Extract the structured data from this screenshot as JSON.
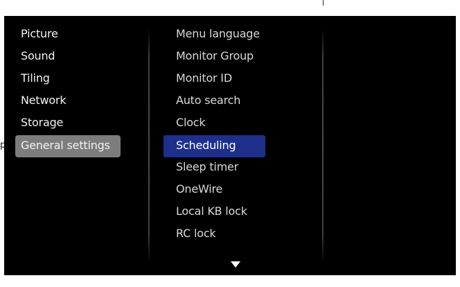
{
  "left_menu": {
    "items": [
      {
        "label": "Picture"
      },
      {
        "label": "Sound"
      },
      {
        "label": "Tiling"
      },
      {
        "label": "Network"
      },
      {
        "label": "Storage"
      },
      {
        "label": "General settings"
      }
    ],
    "selected_label": "General settings"
  },
  "sub_menu": {
    "items": [
      {
        "label": "Menu language"
      },
      {
        "label": "Monitor Group"
      },
      {
        "label": "Monitor ID"
      },
      {
        "label": "Auto search"
      },
      {
        "label": "Clock"
      },
      {
        "label": "Scheduling"
      },
      {
        "label": "Sleep timer"
      },
      {
        "label": "OneWire"
      },
      {
        "label": "Local KB lock"
      },
      {
        "label": "RC lock"
      }
    ],
    "selected_label": "Scheduling",
    "more_indicator": "down-triangle-icon"
  },
  "colors": {
    "background": "#000000",
    "left_selected": "#7d7d7d",
    "sub_selected": "#1e2f8c",
    "text": "#ffffff"
  },
  "edge_mark": "p"
}
